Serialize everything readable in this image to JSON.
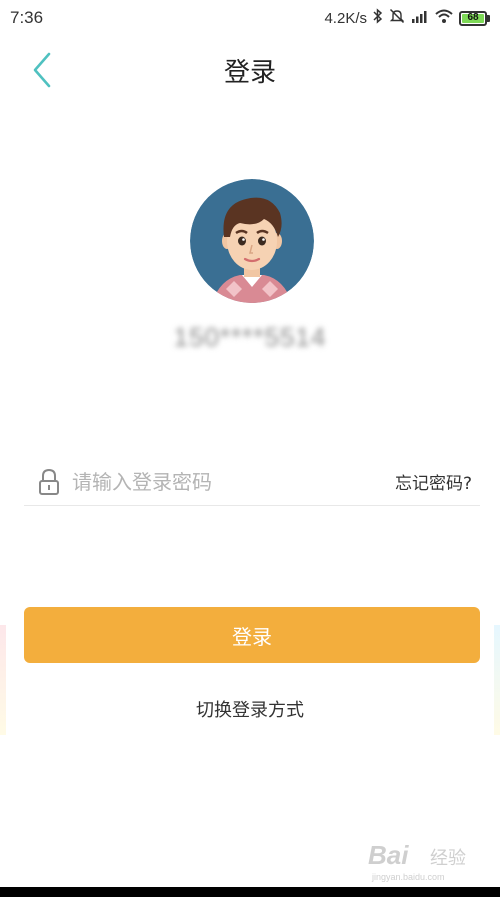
{
  "status_bar": {
    "time": "7:36",
    "net_speed": "4.2K/s",
    "battery_level": "68",
    "icons": [
      "bluetooth-icon",
      "mute-icon",
      "signal-icon",
      "wifi-icon",
      "battery-icon"
    ]
  },
  "header": {
    "back_icon": "chevron-left-icon",
    "title": "登录"
  },
  "user": {
    "avatar_icon": "cartoon-boy-avatar",
    "account": "150****5514"
  },
  "form": {
    "lock_icon": "lock-icon",
    "password_placeholder": "请输入登录密码",
    "password_value": "",
    "forgot_label": "忘记密码?"
  },
  "actions": {
    "login_label": "登录",
    "switch_label": "切换登录方式"
  },
  "watermark": {
    "brand": "Bai",
    "brand_suffix": "经验",
    "url": "jingyan.baidu.com"
  },
  "colors": {
    "accent": "#f3ae3d",
    "back_icon": "#4fc1c0",
    "avatar_bg": "#3a6f93",
    "battery": "#7ed957"
  }
}
